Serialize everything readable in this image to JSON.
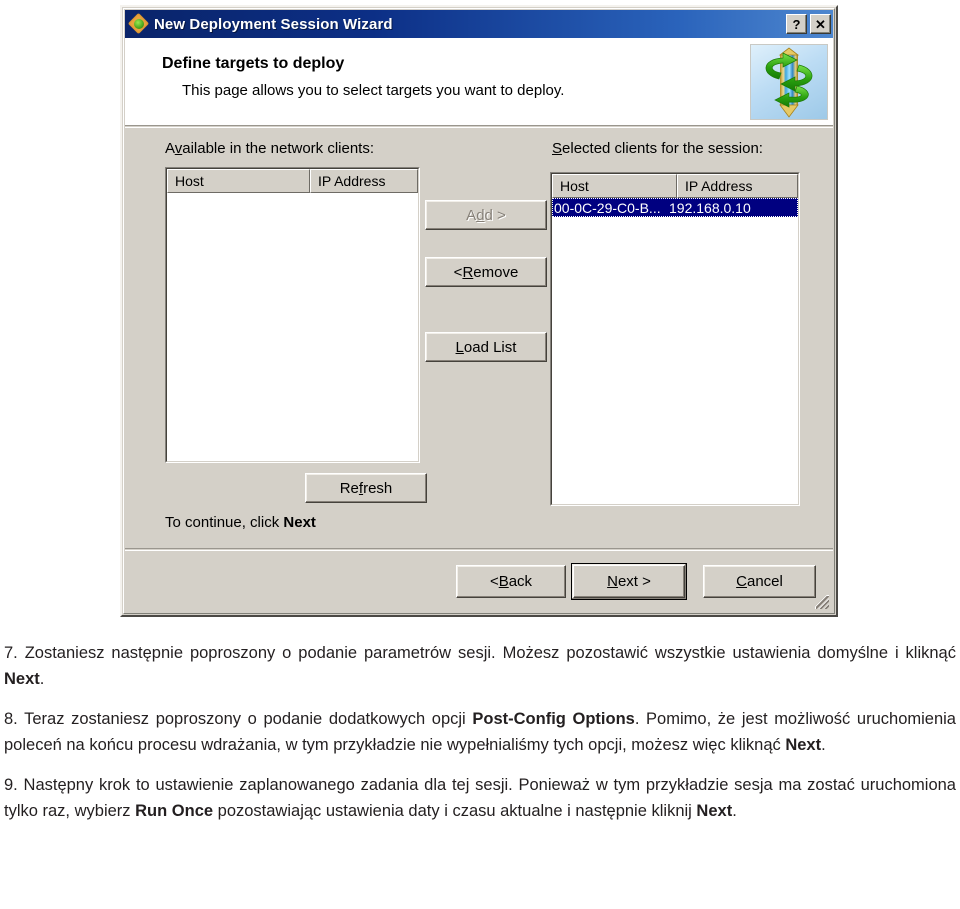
{
  "dialog": {
    "title": "New Deployment Session Wizard",
    "title_icon": "deployment-wizard-icon",
    "help_button": "?",
    "close_button": "✕",
    "header": {
      "title": "Define targets to deploy",
      "subtitle": "This page allows you to select targets you want to deploy.",
      "icon": "deploy-cylinder-arrows-icon"
    },
    "left_panel": {
      "label_pre": "A",
      "label_accel": "v",
      "label_post": "ailable in the network clients:",
      "columns": [
        "Host",
        "IP Address"
      ],
      "rows": []
    },
    "right_panel": {
      "label_accel": "S",
      "label_post": "elected clients for the session:",
      "columns": [
        "Host",
        "IP Address"
      ],
      "rows": [
        {
          "host": "00-0C-29-C0-B...",
          "ip": "192.168.0.10",
          "selected": true
        }
      ]
    },
    "transfer_buttons": [
      {
        "name": "add-button",
        "pre": "A",
        "accel": "d",
        "post": "d >",
        "disabled": true
      },
      {
        "name": "remove-button",
        "pre": "< ",
        "accel": "R",
        "post": "emove",
        "disabled": false
      },
      {
        "name": "load-list-button",
        "pre": "",
        "accel": "L",
        "post": "oad List",
        "disabled": false
      }
    ],
    "refresh_button": {
      "pre": "Re",
      "accel": "f",
      "post": "resh"
    },
    "continue_text_pre": "To continue, click ",
    "continue_text_bold": "Next",
    "footer_buttons": [
      {
        "name": "back-button",
        "pre": "< ",
        "accel": "B",
        "post": "ack",
        "default": false
      },
      {
        "name": "next-button",
        "pre": "",
        "accel": "N",
        "post": "ext >",
        "default": true
      },
      {
        "name": "cancel-button",
        "pre": "",
        "accel": "C",
        "post": "ancel",
        "default": false
      }
    ],
    "resize_grip": "resize-grip"
  },
  "document": {
    "paragraphs": [
      {
        "id": "step-7",
        "parts": [
          {
            "t": "7. Zostaniesz następnie poproszony o podanie parametrów sesji. Możesz pozostawić wszystkie ustawienia domyślne i kliknąć ",
            "b": false
          },
          {
            "t": "Next",
            "b": true
          },
          {
            "t": ".",
            "b": false
          }
        ]
      },
      {
        "id": "step-8",
        "parts": [
          {
            "t": "8. Teraz zostaniesz poproszony o podanie dodatkowych opcji ",
            "b": false
          },
          {
            "t": "Post-Config Options",
            "b": true
          },
          {
            "t": ". Pomimo, że jest możliwość uruchomienia poleceń na końcu procesu wdrażania, w tym przykładzie nie wypełnialiśmy tych opcji, możesz więc kliknąć ",
            "b": false
          },
          {
            "t": "Next",
            "b": true
          },
          {
            "t": ".",
            "b": false
          }
        ]
      },
      {
        "id": "step-9",
        "parts": [
          {
            "t": "9. Następny krok to ustawienie zaplanowanego zadania dla tej sesji. Ponieważ w tym przykładzie sesja ma zostać uruchomiona tylko raz, wybierz ",
            "b": false
          },
          {
            "t": "Run Once",
            "b": true
          },
          {
            "t": " pozostawiając ustawienia daty i czasu aktualne i następnie kliknij ",
            "b": false
          },
          {
            "t": "Next",
            "b": true
          },
          {
            "t": ".",
            "b": false
          }
        ]
      }
    ]
  }
}
